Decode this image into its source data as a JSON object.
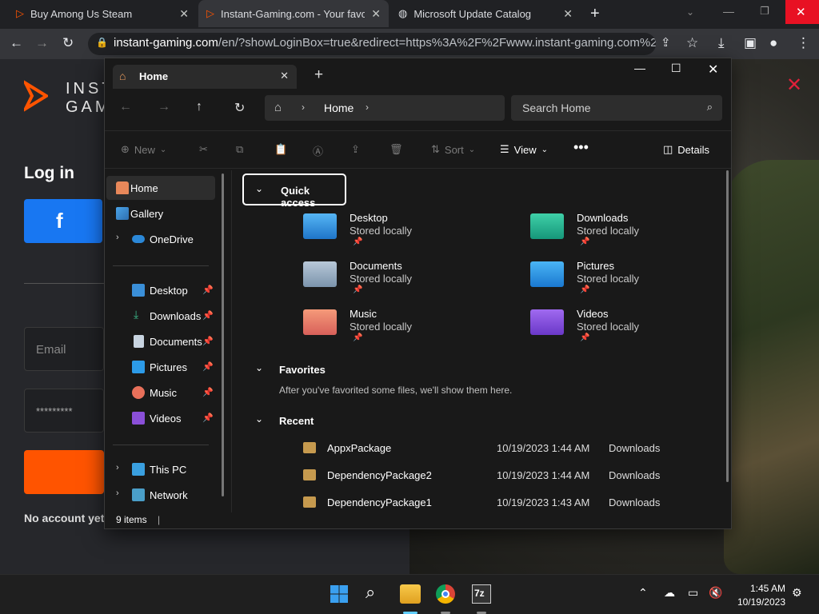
{
  "browser": {
    "tabs": [
      {
        "title": "Buy Among Us Steam"
      },
      {
        "title": "Instant-Gaming.com - Your favo"
      },
      {
        "title": "Microsoft Update Catalog"
      }
    ],
    "url_host": "instant-gaming.com",
    "url_path": "/en/?showLoginBox=true&redirect=https%3A%2F%2Fwww.instant-gaming.com%2Fen..."
  },
  "site": {
    "logo_text_1": "INST",
    "logo_text_2": "GAM",
    "login_title": "Log in",
    "email_placeholder": "Email",
    "password_mask": "*********",
    "no_account": "No account yet?",
    "close_glyph": "✕"
  },
  "explorer": {
    "tab_title": "Home",
    "breadcrumb": "Home",
    "search_placeholder": "Search Home",
    "commands": {
      "new": "New",
      "sort": "Sort",
      "view": "View",
      "details": "Details"
    },
    "nav": [
      {
        "label": "Home",
        "icon": "home-icon"
      },
      {
        "label": "Gallery",
        "icon": "gallery-icon"
      },
      {
        "label": "OneDrive",
        "icon": "cloud-icon"
      },
      {
        "label": "Desktop",
        "icon": "desktop-icon"
      },
      {
        "label": "Downloads",
        "icon": "downloads-icon"
      },
      {
        "label": "Documents",
        "icon": "documents-icon"
      },
      {
        "label": "Pictures",
        "icon": "pictures-icon"
      },
      {
        "label": "Music",
        "icon": "music-icon"
      },
      {
        "label": "Videos",
        "icon": "videos-icon"
      },
      {
        "label": "This PC",
        "icon": "pc-icon"
      },
      {
        "label": "Network",
        "icon": "network-icon"
      }
    ],
    "quick_access_title": "Quick access",
    "quick_access": [
      {
        "name": "Desktop",
        "sub": "Stored locally"
      },
      {
        "name": "Downloads",
        "sub": "Stored locally"
      },
      {
        "name": "Documents",
        "sub": "Stored locally"
      },
      {
        "name": "Pictures",
        "sub": "Stored locally"
      },
      {
        "name": "Music",
        "sub": "Stored locally"
      },
      {
        "name": "Videos",
        "sub": "Stored locally"
      }
    ],
    "favorites_title": "Favorites",
    "favorites_empty": "After you've favorited some files, we'll show them here.",
    "recent_title": "Recent",
    "recent": [
      {
        "name": "AppxPackage",
        "date": "10/19/2023 1:44 AM",
        "location": "Downloads"
      },
      {
        "name": "DependencyPackage2",
        "date": "10/19/2023 1:44 AM",
        "location": "Downloads"
      },
      {
        "name": "DependencyPackage1",
        "date": "10/19/2023 1:43 AM",
        "location": "Downloads"
      }
    ],
    "status": "9 items"
  },
  "taskbar": {
    "time": "1:45 AM",
    "date": "10/19/2023"
  },
  "colors": {
    "accent_orange": "#ff5400",
    "facebook_blue": "#1877f2",
    "explorer_bg": "#191919"
  }
}
